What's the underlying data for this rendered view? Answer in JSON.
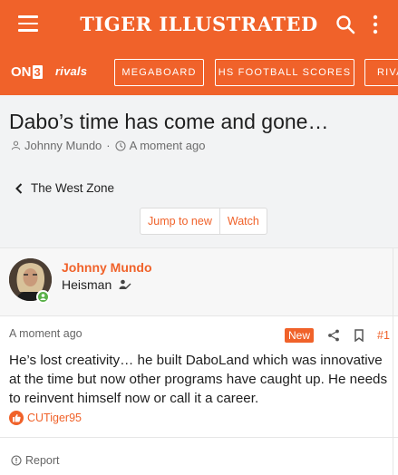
{
  "header": {
    "brand": "TIGER ILLUSTRATED"
  },
  "nav": {
    "on3_a": "ON",
    "on3_b": "3",
    "rivals": "rivals",
    "items": [
      "MEGABOARD",
      "HS FOOTBALL SCORES",
      "RIVA"
    ]
  },
  "thread": {
    "title": "Dabo’s time has come and gone…",
    "author": "Johnny Mundo",
    "separator": "·",
    "time": "A moment ago",
    "breadcrumb": "The West Zone",
    "jump_label": "Jump to new",
    "watch_label": "Watch"
  },
  "post": {
    "author": "Johnny Mundo",
    "rank": "Heisman",
    "time": "A moment ago",
    "badge": "New",
    "number": "#1",
    "body": "He’s lost creativity… he built DaboLand which was innovative at the time but now other programs have caught up. He needs to reinvent himself now or call it a career.",
    "reaction_user": "CUTiger95",
    "report_label": "Report"
  },
  "colors": {
    "brand": "#f0622a",
    "background": "#f2f3f4",
    "online": "#5bb14a"
  },
  "icons": [
    "menu-icon",
    "search-icon",
    "more-vertical-icon",
    "user-icon",
    "clock-icon",
    "chevron-left-icon",
    "avatar",
    "online-indicator-icon",
    "user-edit-icon",
    "share-icon",
    "bookmark-icon",
    "like-icon",
    "report-icon"
  ]
}
